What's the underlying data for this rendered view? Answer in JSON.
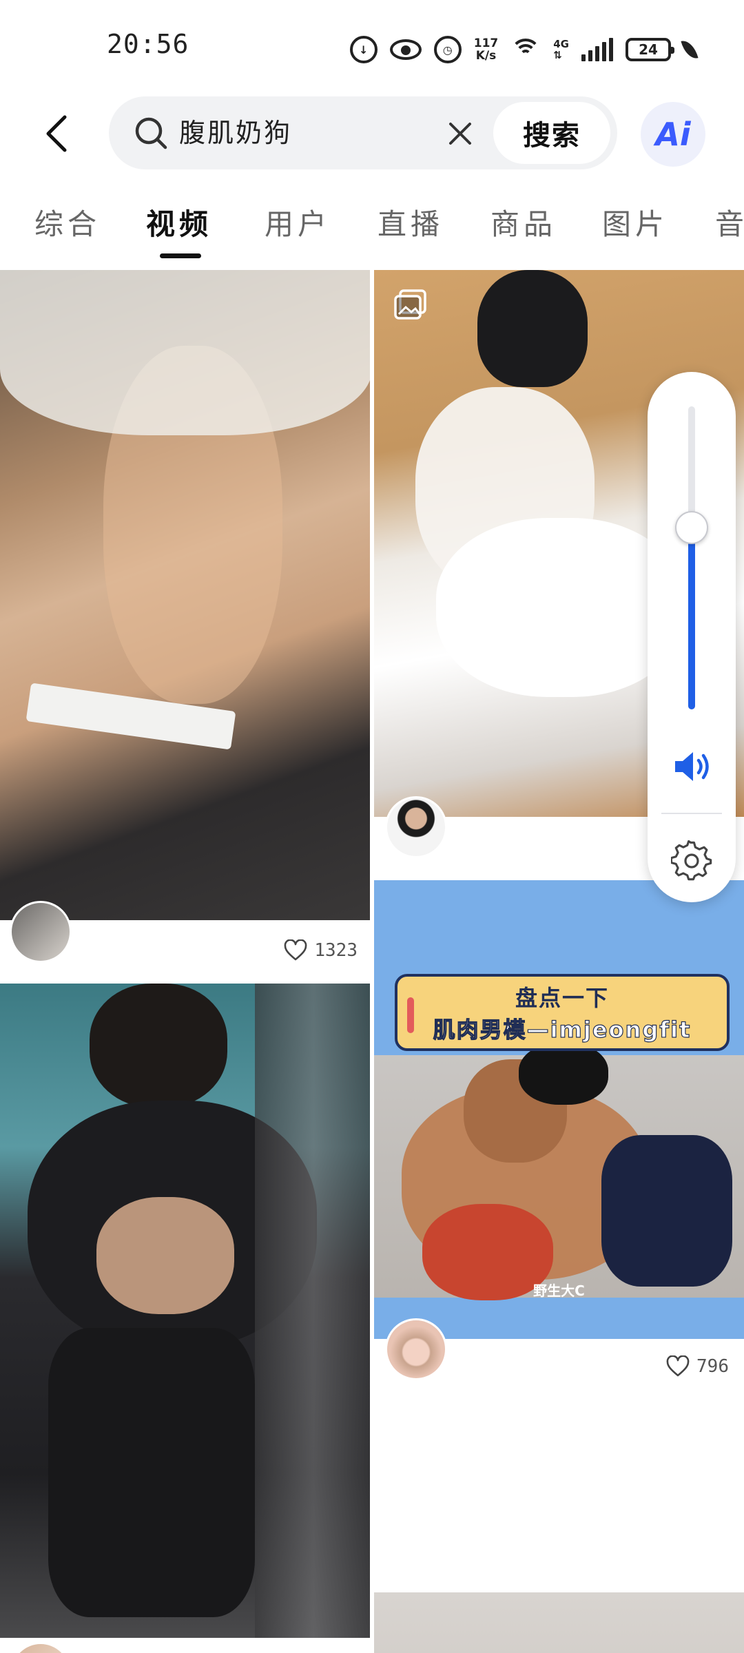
{
  "status_bar": {
    "time": "20:56",
    "speed_value": "117",
    "speed_unit": "K/s",
    "network_type": "4G",
    "battery": "24",
    "icons": [
      "data-saver-icon",
      "eye-icon",
      "alarm-icon",
      "wifi-icon",
      "signal-icon",
      "battery-icon",
      "leaf-icon"
    ]
  },
  "header": {
    "search_query": "腹肌奶狗",
    "search_button_label": "搜索",
    "ai_label": "Ai"
  },
  "tabs": [
    "综合",
    "视频",
    "用户",
    "直播",
    "商品",
    "图片",
    "音"
  ],
  "active_tab_index": 1,
  "feed": {
    "cards": [
      {
        "column": "left",
        "likes": "1323"
      },
      {
        "column": "right",
        "likes": ""
      },
      {
        "column": "left",
        "likes": ""
      },
      {
        "column": "right",
        "likes": "796",
        "banner_line1": "盘点一下",
        "banner_line2": "肌肉男模—imjeongfit",
        "watermark": "野生大C"
      },
      {
        "column": "right",
        "likes": ""
      }
    ]
  },
  "volume": {
    "level": 0.6
  },
  "colors": {
    "accent_blue": "#1f5fe6",
    "ai_blue": "#3b5bfd",
    "search_bg": "#f1f2f4"
  }
}
